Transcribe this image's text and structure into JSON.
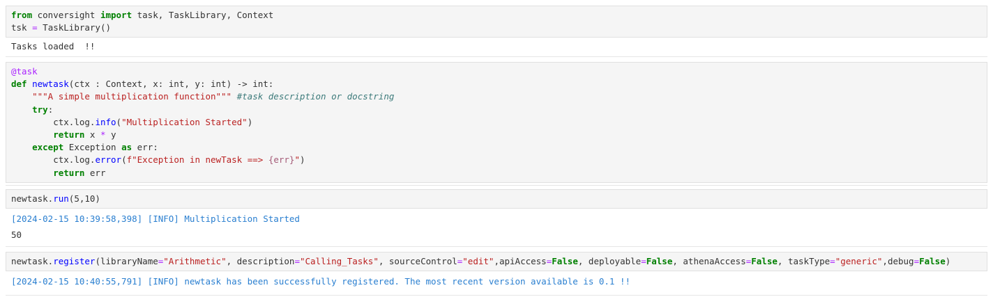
{
  "cells": {
    "c1": {
      "kw_from": "from",
      "module": " conversight ",
      "kw_import": "import",
      "names": " task, TaskLibrary, Context",
      "l2_var": "tsk ",
      "l2_eq": "=",
      "l2_call": " TaskLibrary()",
      "output": "Tasks loaded  !!"
    },
    "c2": {
      "decorator": "@task",
      "def_kw": "def",
      "fn_name": "newtask",
      "sig": "(ctx : Context, x: int, y: int) -> int:",
      "indent4": "    ",
      "indent8": "        ",
      "docstring": "\"\"\"A simple multiplication function\"\"\"",
      "comment": " #task description or docstring",
      "try_kw": "try",
      "colon": ":",
      "ctx_log_a": "ctx.log.",
      "info": "info",
      "info_args_open": "(",
      "info_str": "\"Multiplication Started\"",
      "info_args_close": ")",
      "return_kw": "return",
      "ret_x": " x ",
      "mul": "*",
      "ret_y": " y",
      "except_kw": "except",
      "exception_name": " Exception ",
      "as_kw": "as",
      "err_name": " err:",
      "ctx_log_b": "ctx.log.",
      "error": "error",
      "error_open": "(",
      "fstr_a": "f\"Exception in newTask ==> ",
      "fstr_interp": "{err}",
      "fstr_b": "\"",
      "error_close": ")",
      "return_kw2": "return",
      "ret_err": " err"
    },
    "c3": {
      "obj": "newtask.",
      "method": "run",
      "args": "(5,10)",
      "log_output": "[2024-02-15 10:39:58,398] [INFO] Multiplication Started",
      "result": "50"
    },
    "c4": {
      "obj": "newtask.",
      "method": "register",
      "p1": "(libraryName",
      "eq": "=",
      "v1": "\"Arithmetic\"",
      "p2": ", description",
      "v2": "\"Calling_Tasks\"",
      "p3": ", sourceControl",
      "v3": "\"edit\"",
      "p4": ",apiAccess",
      "v4": "False",
      "p5": ", deployable",
      "v5": "False",
      "p6": ", athenaAccess",
      "v6": "False",
      "p7": ", taskType",
      "v7": "\"generic\"",
      "p8": ",debug",
      "v8": "False",
      "close": ")",
      "log_output": "[2024-02-15 10:40:55,791] [INFO] newtask has been successfully registered. The most recent version available is 0.1 !!"
    }
  }
}
